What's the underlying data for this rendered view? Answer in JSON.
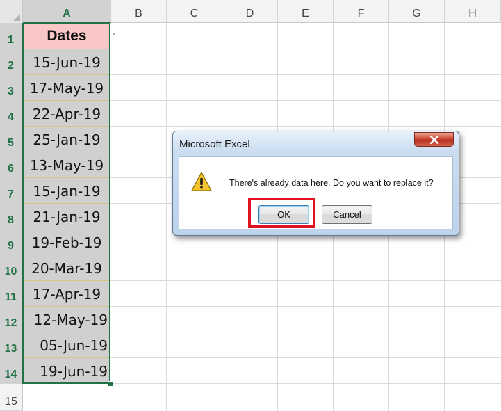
{
  "columns": [
    "A",
    "B",
    "C",
    "D",
    "E",
    "F",
    "G",
    "H"
  ],
  "rows": [
    "1",
    "2",
    "3",
    "4",
    "5",
    "6",
    "7",
    "8",
    "9",
    "10",
    "11",
    "12",
    "13",
    "14",
    "15"
  ],
  "cells": {
    "A1": "Dates",
    "B1": "`",
    "A_values": [
      "15-Jun-19",
      "17-May-19",
      "22-Apr-19",
      "25-Jan-19",
      "13-May-19",
      "15-Jan-19",
      "21-Jan-19",
      "19-Feb-19",
      "20-Mar-19",
      "17-Apr-19",
      "12-May-19",
      "05-Jun-19",
      "19-Jun-19"
    ]
  },
  "dialog": {
    "title": "Microsoft Excel",
    "message": "There's already data here. Do you want to replace it?",
    "ok_label": "OK",
    "cancel_label": "Cancel",
    "icon": "warning-icon",
    "close_icon": "close-icon"
  },
  "colors": {
    "header_fill": "#f9c8c6",
    "data_fill": "#d0d0d0",
    "selection": "#217346",
    "highlight_box": "#e0121e"
  }
}
